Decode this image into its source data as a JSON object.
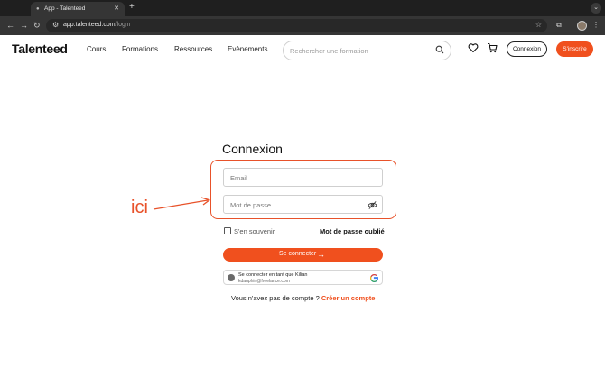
{
  "browser": {
    "tab_title": "App - Talenteed",
    "tab_close": "✕",
    "new_tab": "+",
    "url_host": "app.talenteed.com",
    "url_path": "/login"
  },
  "site": {
    "logo": "Talenteed",
    "nav": [
      "Cours",
      "Formations",
      "Ressources",
      "Evènements"
    ],
    "search_placeholder": "Rechercher une formation",
    "connexion_button": "Connexion",
    "signup_button": "S'inscrire"
  },
  "login": {
    "title": "Connexion",
    "email_placeholder": "Email",
    "password_placeholder": "Mot de passe",
    "remember_label": "S'en souvenir",
    "forgot_link": "Mot de passe oublié",
    "submit_label": "Se connecter",
    "google_line1": "Se connecter en tant que Kilian",
    "google_line2": "kdauphin@freelance.com",
    "no_account_text": "Vous n'avez pas de compte ? ",
    "create_account_link": "Créer un compte"
  },
  "annotation": {
    "label": "ici",
    "color": "#e8522a"
  },
  "colors": {
    "accent": "#f0501e",
    "chrome_dark": "#1f1f1f"
  },
  "icons": {
    "search": "search-icon",
    "heart": "heart-icon",
    "cart": "cart-icon",
    "eye_off": "eye-off-icon",
    "google": "google-icon"
  }
}
